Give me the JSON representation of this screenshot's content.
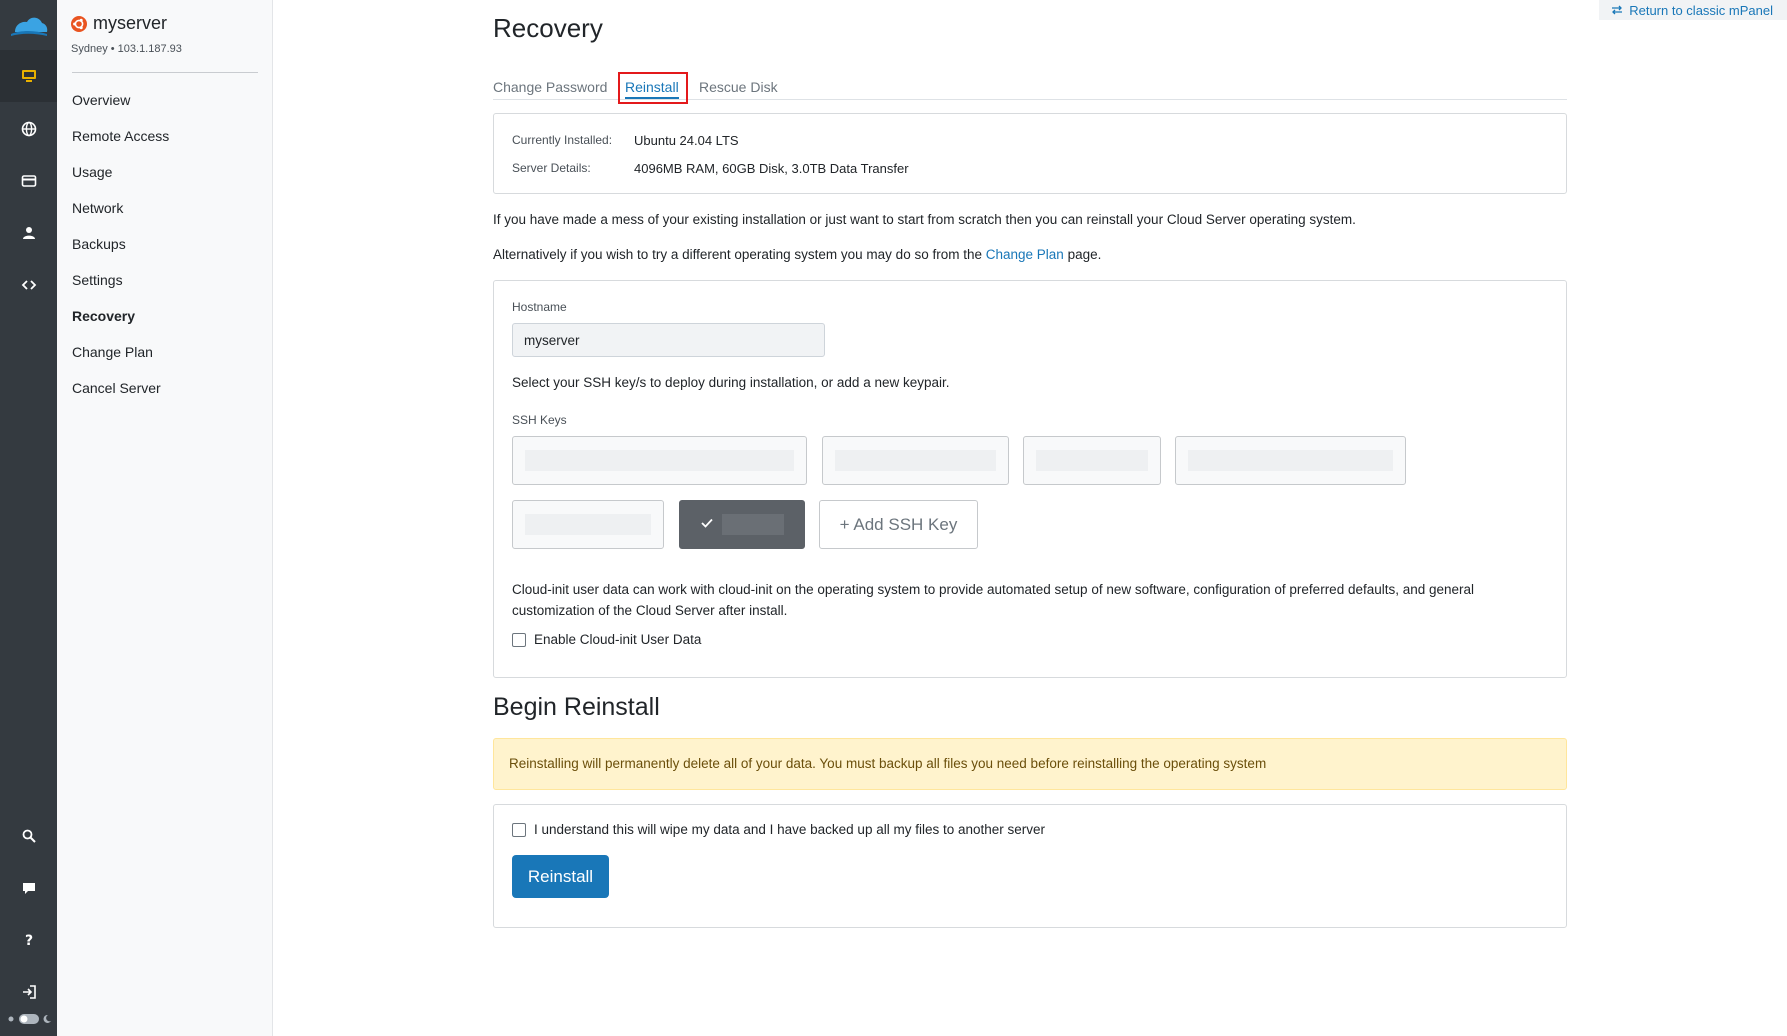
{
  "app": {
    "return_link": "Return to classic mPanel"
  },
  "server": {
    "name": "myserver",
    "location": "Sydney • 103.1.187.93"
  },
  "sidebar": {
    "items": [
      {
        "label": "Overview"
      },
      {
        "label": "Remote Access"
      },
      {
        "label": "Usage"
      },
      {
        "label": "Network"
      },
      {
        "label": "Backups"
      },
      {
        "label": "Settings"
      },
      {
        "label": "Recovery",
        "active": true
      },
      {
        "label": "Change Plan"
      },
      {
        "label": "Cancel Server"
      }
    ]
  },
  "rail": {
    "icons": [
      "cloud-logo-icon",
      "monitor-icon",
      "globe-icon",
      "card-icon",
      "user-icon",
      "code-icon",
      "search-icon",
      "chat-icon",
      "help-icon",
      "logout-icon",
      "theme-toggle-icon"
    ]
  },
  "page": {
    "title": "Recovery",
    "tabs": [
      {
        "label": "Change Password"
      },
      {
        "label": "Reinstall",
        "active": true
      },
      {
        "label": "Rescue Disk"
      }
    ]
  },
  "info": {
    "installed_label": "Currently Installed:",
    "installed_value": "Ubuntu 24.04 LTS",
    "details_label": "Server Details:",
    "details_value": "4096MB RAM, 60GB Disk, 3.0TB Data Transfer"
  },
  "intro": {
    "p1": "If you have made a mess of your existing installation or just want to start from scratch then you can reinstall your Cloud Server operating system.",
    "p2_prefix": "Alternatively if you wish to try a different operating system you may do so from the",
    "p2_link": "Change Plan",
    "p2_suffix": "page."
  },
  "form": {
    "hostname_label": "Hostname",
    "hostname_value": "myserver",
    "ssh_hint": "Select your SSH key/s to deploy during installation, or add a new keypair.",
    "ssh_label": "SSH Keys",
    "add_key_label": "+ Add SSH Key",
    "cloudinit_text_1": "Cloud-init user data can work with cloud-init on the operating system to provide automated setup of new software, configuration of preferred defaults, and general",
    "cloudinit_text_2": "customization of the Cloud Server after install.",
    "cloudinit_checkbox": "Enable Cloud-init User Data"
  },
  "reinstall": {
    "title": "Begin Reinstall",
    "warning": "Reinstalling will permanently delete all of your data. You must backup all files you need before reinstalling the operating system",
    "confirm_label": "I understand this will wipe my data and I have backed up all my files to another server",
    "button": "Reinstall"
  },
  "colors": {
    "primary": "#1977b8",
    "rail": "#343a40",
    "warning_bg": "#fff3cd",
    "highlight": "#e3191b"
  }
}
